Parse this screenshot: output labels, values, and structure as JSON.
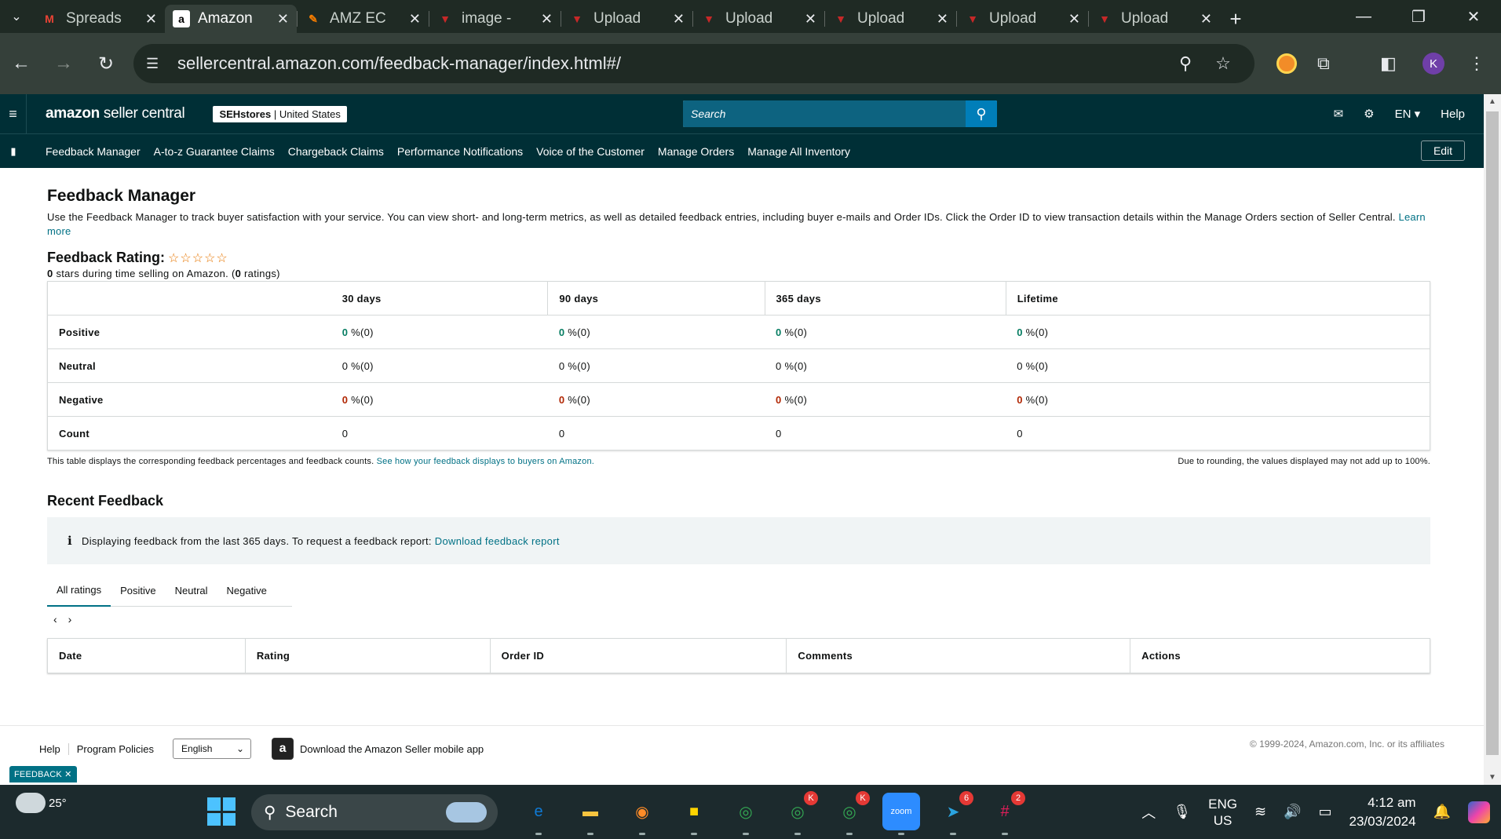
{
  "browser": {
    "tabs": [
      {
        "title": "Spreads",
        "favicon": "gmail-icon",
        "fav_color": "#ea4335",
        "fav_text": "M",
        "active": false
      },
      {
        "title": "Amazon",
        "favicon": "amazon-icon",
        "fav_color": "#ffffff",
        "fav_text": "a",
        "active": true
      },
      {
        "title": "AMZ EC",
        "favicon": "amz-ec-icon",
        "fav_color": "#f57c00",
        "fav_text": "✎",
        "active": false
      },
      {
        "title": "image -",
        "favicon": "upload-icon",
        "fav_color": "#c62828",
        "fav_text": "▼",
        "active": false
      },
      {
        "title": "Upload",
        "favicon": "upload-icon",
        "fav_color": "#c62828",
        "fav_text": "▼",
        "active": false
      },
      {
        "title": "Upload",
        "favicon": "upload-icon",
        "fav_color": "#c62828",
        "fav_text": "▼",
        "active": false
      },
      {
        "title": "Upload",
        "favicon": "upload-icon",
        "fav_color": "#c62828",
        "fav_text": "▼",
        "active": false
      },
      {
        "title": "Upload",
        "favicon": "upload-icon",
        "fav_color": "#c62828",
        "fav_text": "▼",
        "active": false
      },
      {
        "title": "Upload",
        "favicon": "upload-icon",
        "fav_color": "#c62828",
        "fav_text": "▼",
        "active": false
      }
    ],
    "url": "sellercentral.amazon.com/feedback-manager/index.html#/",
    "profile_initial": "K"
  },
  "header": {
    "logo_bold": "amazon",
    "logo_rest": " seller central",
    "store_name": "SEHstores",
    "store_region": "United States",
    "search_placeholder": "Search",
    "language": "EN",
    "help": "Help"
  },
  "nav": {
    "links": [
      "Feedback Manager",
      "A-to-z Guarantee Claims",
      "Chargeback Claims",
      "Performance Notifications",
      "Voice of the Customer",
      "Manage Orders",
      "Manage All Inventory"
    ],
    "edit": "Edit"
  },
  "page": {
    "title": "Feedback Manager",
    "intro": "Use the Feedback Manager to track buyer satisfaction with your service. You can view short- and long-term metrics, as well as detailed feedback entries, including buyer e-mails and Order IDs. Click the Order ID to view transaction details within the Manage Orders section of Seller Central.",
    "learn_more": "Learn more",
    "rating_label": "Feedback Rating:",
    "stars": "☆☆☆☆☆",
    "rating_stars_value": "0",
    "rating_sub_mid": " stars during time selling on Amazon. (",
    "rating_count": "0",
    "rating_sub_end": " ratings)"
  },
  "feedback_table": {
    "columns": [
      "",
      "30 days",
      "90 days",
      "365 days",
      "Lifetime"
    ],
    "rows": [
      {
        "label": "Positive",
        "kind": "positive",
        "cells": [
          {
            "num": "0",
            "rest": " %(0)"
          },
          {
            "num": "0",
            "rest": " %(0)"
          },
          {
            "num": "0",
            "rest": " %(0)"
          },
          {
            "num": "0",
            "rest": " %(0)"
          }
        ]
      },
      {
        "label": "Neutral",
        "kind": "neutral",
        "cells": [
          {
            "num": "0",
            "rest": " %(0)"
          },
          {
            "num": "0",
            "rest": " %(0)"
          },
          {
            "num": "0",
            "rest": " %(0)"
          },
          {
            "num": "0",
            "rest": " %(0)"
          }
        ]
      },
      {
        "label": "Negative",
        "kind": "negative",
        "cells": [
          {
            "num": "0",
            "rest": " %(0)"
          },
          {
            "num": "0",
            "rest": " %(0)"
          },
          {
            "num": "0",
            "rest": " %(0)"
          },
          {
            "num": "0",
            "rest": " %(0)"
          }
        ]
      },
      {
        "label": "Count",
        "kind": "count",
        "cells": [
          {
            "num": "0",
            "rest": ""
          },
          {
            "num": "0",
            "rest": ""
          },
          {
            "num": "0",
            "rest": ""
          },
          {
            "num": "0",
            "rest": ""
          }
        ]
      }
    ],
    "note_left": "This table displays the corresponding feedback percentages and feedback counts.",
    "note_link": "See how your feedback displays to buyers on Amazon.",
    "note_right": "Due to rounding, the values displayed may not add up to 100%."
  },
  "recent": {
    "title": "Recent Feedback",
    "alert_text": "Displaying feedback from the last 365 days. To request a feedback report:",
    "alert_link": "Download feedback report",
    "tabs": [
      "All ratings",
      "Positive",
      "Neutral",
      "Negative"
    ],
    "columns": [
      "Date",
      "Rating",
      "Order ID",
      "Comments",
      "Actions"
    ]
  },
  "footer": {
    "help": "Help",
    "policies": "Program Policies",
    "language": "English",
    "app_download": "Download the Amazon Seller mobile app",
    "copyright": "© 1999-2024, Amazon.com, Inc. or its affiliates",
    "feedback_badge": "FEEDBACK ✕"
  },
  "taskbar": {
    "temperature": "25°",
    "search_label": "Search",
    "apps": [
      {
        "name": "edge-icon",
        "color": "#0f7bd8",
        "glyph": "e",
        "badge": ""
      },
      {
        "name": "file-explorer-icon",
        "color": "#f6c43f",
        "glyph": "▬",
        "badge": ""
      },
      {
        "name": "brave-icon",
        "color": "#ff8c28",
        "glyph": "◉",
        "badge": ""
      },
      {
        "name": "sticky-notes-icon",
        "color": "#ffd400",
        "glyph": "■",
        "badge": ""
      },
      {
        "name": "chrome-icon",
        "color": "#34a853",
        "glyph": "◎",
        "badge": ""
      },
      {
        "name": "chrome-profile-icon",
        "color": "#34a853",
        "glyph": "◎",
        "badge": "K"
      },
      {
        "name": "chrome-active-icon",
        "color": "#34a853",
        "glyph": "◎",
        "badge": "K"
      },
      {
        "name": "zoom-icon",
        "color": "#2d8cff",
        "glyph": "zoom",
        "badge": ""
      },
      {
        "name": "telegram-icon",
        "color": "#2aa3df",
        "glyph": "➤",
        "badge": "6"
      },
      {
        "name": "slack-icon",
        "color": "#e01e5a",
        "glyph": "#",
        "badge": "2"
      }
    ],
    "lang_top": "ENG",
    "lang_bottom": "US",
    "time": "4:12 am",
    "date": "23/03/2024"
  }
}
